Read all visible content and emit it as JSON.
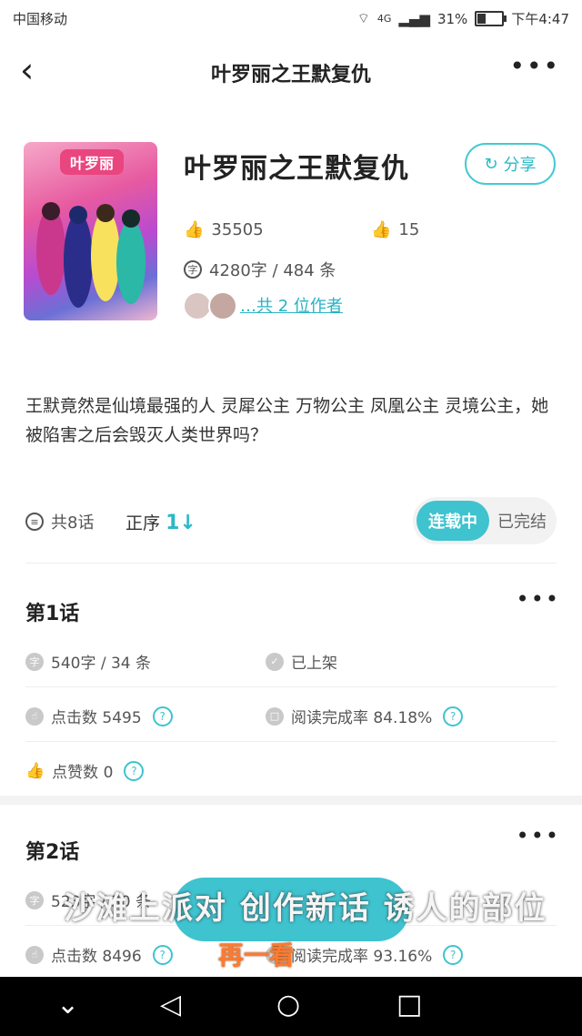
{
  "status_bar": {
    "carrier": "中国移动",
    "signal": "4G",
    "battery": "31%",
    "time": "下午4:47"
  },
  "nav": {
    "title": "叶罗丽之王默复仇"
  },
  "book": {
    "cover_text": "叶罗丽",
    "title": "叶罗丽之王默复仇",
    "share_label": "分享",
    "likes": "35505",
    "thumbs": "15",
    "word_info": "4280字 / 484 条",
    "authors_link": "…共 2 位作者",
    "description": "王默竟然是仙境最强的人 灵犀公主 万物公主 凤凰公主 灵境公主，她被陷害之后会毁灭人类世界吗？"
  },
  "toolbar": {
    "ep_count": "共8话",
    "sort_label": "正序",
    "sort_arrow": "1↓",
    "seg_on": "连载中",
    "seg_off": "已完结"
  },
  "episodes": [
    {
      "title": "第1话",
      "words": "540字 / 34 条",
      "status": "已上架",
      "clicks": "点击数 5495",
      "completion": "阅读完成率 84.18%",
      "likes": "点赞数 0"
    },
    {
      "title": "第2话",
      "words": "523字 / 30 条",
      "clicks": "点击数 8496",
      "completion": "阅读完成率 93.16%"
    }
  ],
  "overlay": {
    "main_text": "沙滩上派对 创作新话 诱人的部位",
    "sub_text": "再一看"
  },
  "icons": {
    "back": "chevron-left-icon",
    "more": "more-horizontal-icon",
    "share": "share-icon",
    "like": "thumb-icon",
    "word": "word-count-icon",
    "list": "list-icon"
  },
  "colors": {
    "accent": "#3ec3cf",
    "link": "#28b1c3",
    "overlay_orange": "#ff7a2e"
  }
}
